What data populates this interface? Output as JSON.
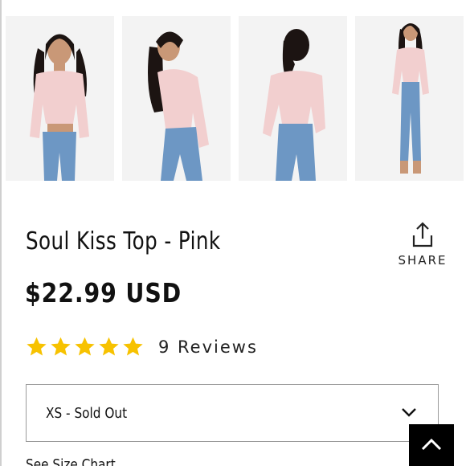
{
  "gallery": {
    "images": [
      {
        "alt": "front view"
      },
      {
        "alt": "side view"
      },
      {
        "alt": "back view"
      },
      {
        "alt": "full body view"
      }
    ]
  },
  "product": {
    "title": "Soul Kiss Top - Pink",
    "price": "$22.99 USD",
    "rating_stars": 5,
    "reviews_label": "9 Reviews"
  },
  "share": {
    "label": "SHARE"
  },
  "size_select": {
    "selected": "XS - Sold Out"
  },
  "size_chart_link": "See Size Chart",
  "colors": {
    "star": "#f7c200",
    "top_pink": "#f2cfcf",
    "denim": "#6d97c4",
    "skin": "#c99877",
    "hair": "#1c1412"
  }
}
